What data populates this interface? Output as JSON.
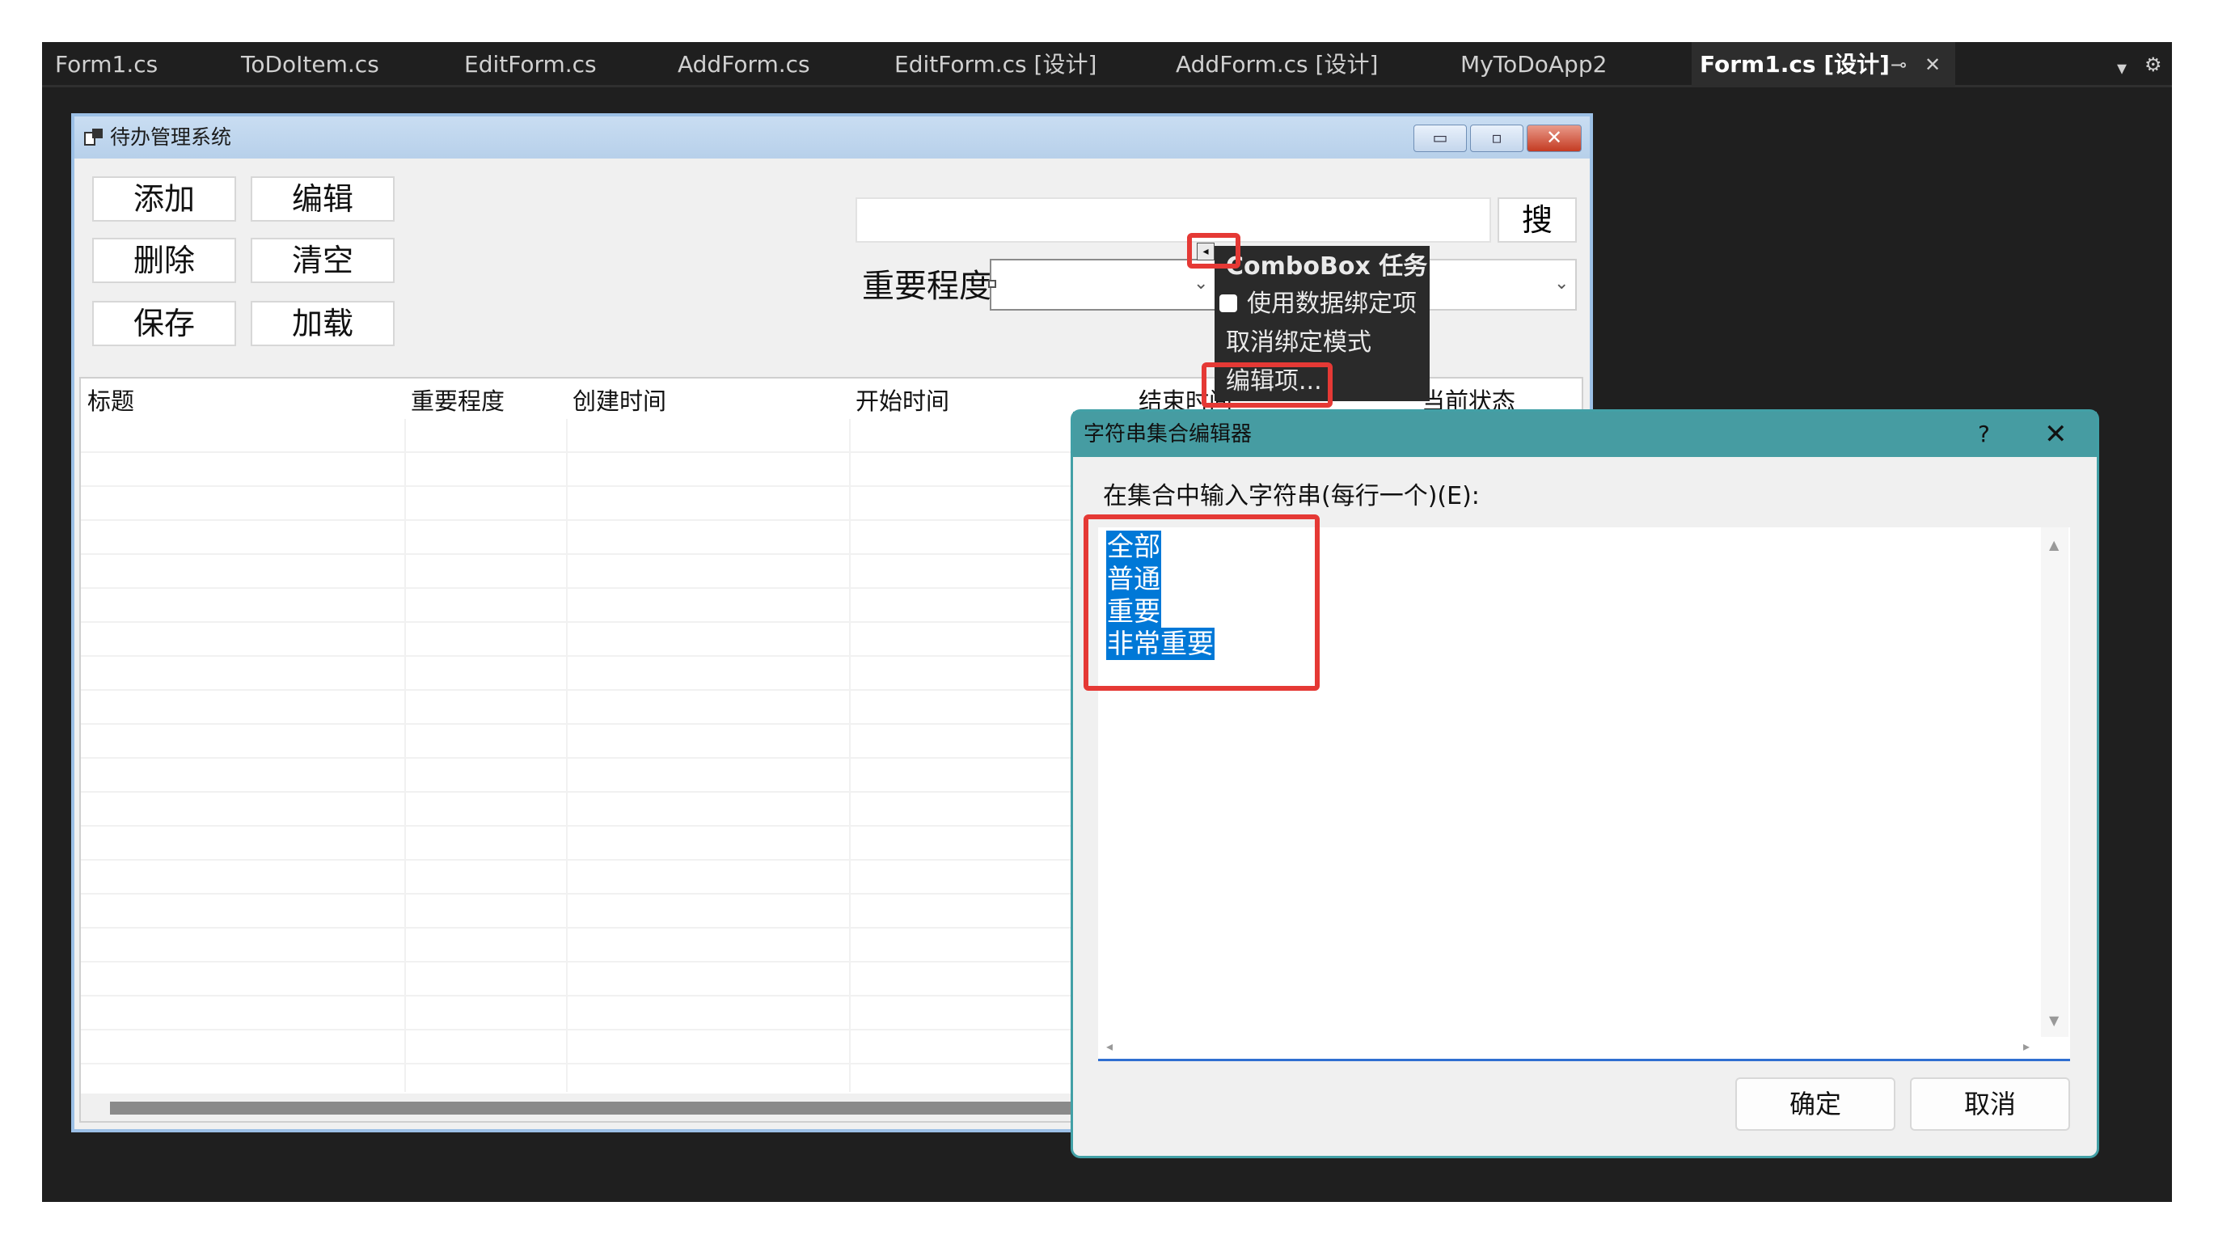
{
  "tabs": [
    {
      "label": "Form1.cs",
      "active": false
    },
    {
      "label": "ToDoItem.cs",
      "active": false
    },
    {
      "label": "EditForm.cs",
      "active": false
    },
    {
      "label": "AddForm.cs",
      "active": false
    },
    {
      "label": "EditForm.cs [设计]",
      "active": false
    },
    {
      "label": "AddForm.cs [设计]",
      "active": false
    },
    {
      "label": "MyToDoApp2",
      "active": false
    },
    {
      "label": "Form1.cs [设计]",
      "active": true
    }
  ],
  "tab_icons": {
    "pin": "⊸",
    "close": "✕",
    "dropdown": "▾",
    "settings": "⚙"
  },
  "form": {
    "title": "待办管理系统",
    "caption_buttons": {
      "minimize": "▭",
      "maximize": "▫",
      "close": "✕"
    },
    "buttons": {
      "add": "添加",
      "edit": "编辑",
      "delete": "删除",
      "clear": "清空",
      "save": "保存",
      "load": "加载"
    },
    "search_button": "搜",
    "importance_label": "重要程度",
    "columns": [
      "标题",
      "重要程度",
      "创建时间",
      "开始时间",
      "结束时间",
      "当前状态"
    ]
  },
  "smart_tag": {
    "arrow": "◂",
    "title": "ComboBox 任务",
    "use_data_bound_items": "使用数据绑定项",
    "unbind_mode": "取消绑定模式",
    "edit_items": "编辑项..."
  },
  "dialog": {
    "title": "字符串集合编辑器",
    "help": "?",
    "close": "✕",
    "prompt": "在集合中输入字符串(每行一个)(E):",
    "items": [
      "全部",
      "普通",
      "重要",
      "非常重要"
    ],
    "ok": "确定",
    "cancel": "取消",
    "scroll_arrows": {
      "up": "▲",
      "down": "▼",
      "left": "◂",
      "right": "▸"
    }
  },
  "colors": {
    "selection": "#0078d7",
    "highlight": "#e53935",
    "dialog_titlebar": "#469ca2",
    "ide_background": "#1f1f1f"
  }
}
